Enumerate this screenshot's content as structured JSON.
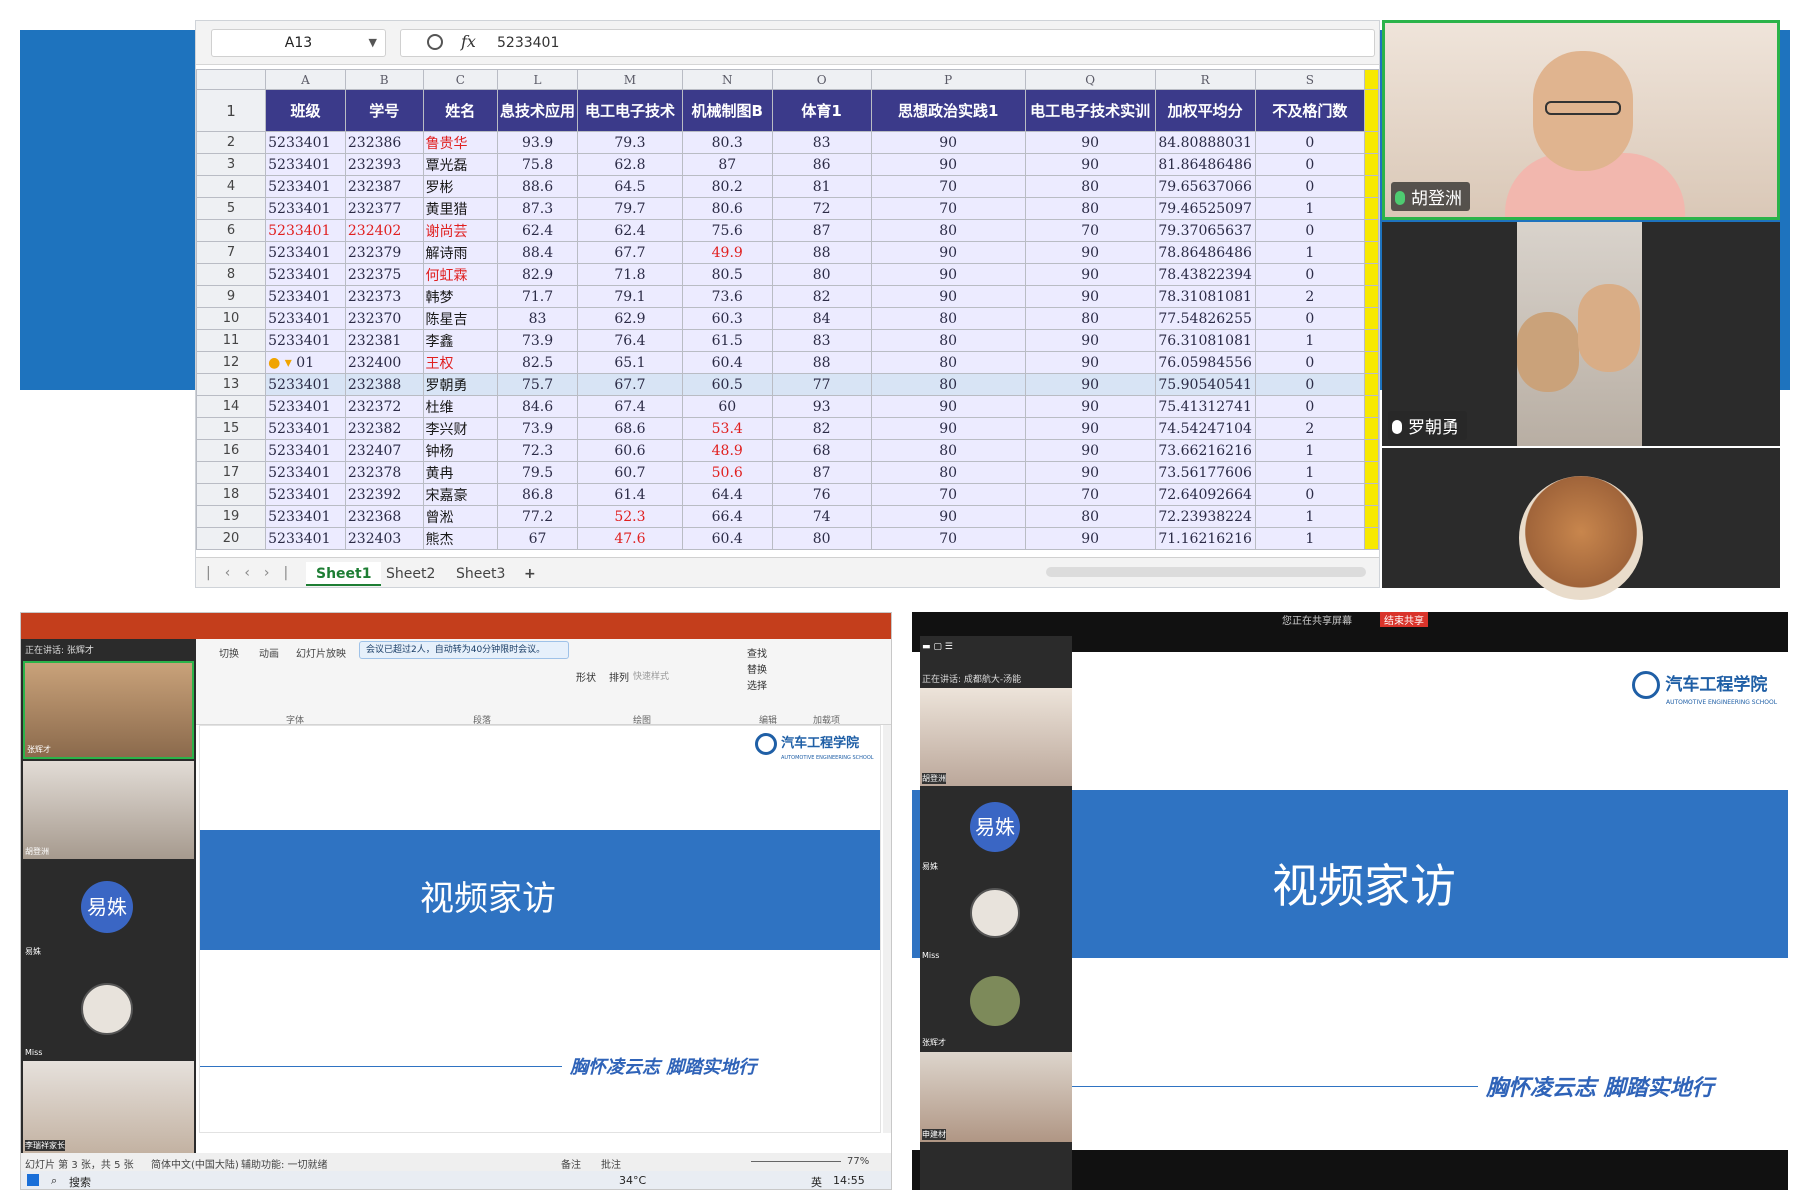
{
  "spreadsheet": {
    "cell_ref": "A13",
    "formula_value": "5233401",
    "column_letters": [
      "A",
      "B",
      "C",
      "L",
      "M",
      "N",
      "O",
      "P",
      "Q",
      "R",
      "S"
    ],
    "headers": [
      "班级",
      "学号",
      "姓名",
      "息技术应用",
      "电工电子技术",
      "机械制图B",
      "体育1",
      "思想政治实践1",
      "电工电子技术实训",
      "加权平均分",
      "不及格门数"
    ],
    "rows": [
      {
        "n": "2",
        "c": [
          "5233401",
          "232386",
          "鲁贵华",
          "93.9",
          "79.3",
          "80.3",
          "83",
          "90",
          "90",
          "84.80888031",
          "0"
        ]
      },
      {
        "n": "3",
        "c": [
          "5233401",
          "232393",
          "覃光磊",
          "75.8",
          "62.8",
          "87",
          "86",
          "90",
          "90",
          "81.86486486",
          "0"
        ]
      },
      {
        "n": "4",
        "c": [
          "5233401",
          "232387",
          "罗彬",
          "88.6",
          "64.5",
          "80.2",
          "81",
          "70",
          "80",
          "79.65637066",
          "0"
        ]
      },
      {
        "n": "5",
        "c": [
          "5233401",
          "232377",
          "黄里猎",
          "87.3",
          "79.7",
          "80.6",
          "72",
          "70",
          "80",
          "79.46525097",
          "1"
        ]
      },
      {
        "n": "6",
        "c": [
          "5233401",
          "232402",
          "谢尚芸",
          "62.4",
          "62.4",
          "75.6",
          "87",
          "80",
          "70",
          "79.37065637",
          "0"
        ]
      },
      {
        "n": "7",
        "c": [
          "5233401",
          "232379",
          "解诗雨",
          "88.4",
          "67.7",
          "49.9",
          "88",
          "90",
          "90",
          "78.86486486",
          "1"
        ]
      },
      {
        "n": "8",
        "c": [
          "5233401",
          "232375",
          "何虹霖",
          "82.9",
          "71.8",
          "80.5",
          "80",
          "90",
          "90",
          "78.43822394",
          "0"
        ]
      },
      {
        "n": "9",
        "c": [
          "5233401",
          "232373",
          "韩梦",
          "71.7",
          "79.1",
          "73.6",
          "82",
          "90",
          "90",
          "78.31081081",
          "2"
        ]
      },
      {
        "n": "10",
        "c": [
          "5233401",
          "232370",
          "陈星吉",
          "83",
          "62.9",
          "60.3",
          "84",
          "80",
          "80",
          "77.54826255",
          "0"
        ]
      },
      {
        "n": "11",
        "c": [
          "5233401",
          "232381",
          "李鑫",
          "73.9",
          "76.4",
          "61.5",
          "83",
          "80",
          "90",
          "76.31081081",
          "1"
        ]
      },
      {
        "n": "12",
        "c": [
          "01",
          "232400",
          "王权",
          "82.5",
          "65.1",
          "60.4",
          "88",
          "80",
          "90",
          "76.05984556",
          "0"
        ]
      },
      {
        "n": "13",
        "c": [
          "5233401",
          "232388",
          "罗朝勇",
          "75.7",
          "67.7",
          "60.5",
          "77",
          "80",
          "90",
          "75.90540541",
          "0"
        ]
      },
      {
        "n": "14",
        "c": [
          "5233401",
          "232372",
          "杜维",
          "84.6",
          "67.4",
          "60",
          "93",
          "90",
          "90",
          "75.41312741",
          "0"
        ]
      },
      {
        "n": "15",
        "c": [
          "5233401",
          "232382",
          "李兴财",
          "73.9",
          "68.6",
          "53.4",
          "82",
          "90",
          "90",
          "74.54247104",
          "2"
        ]
      },
      {
        "n": "16",
        "c": [
          "5233401",
          "232407",
          "钟杨",
          "72.3",
          "60.6",
          "48.9",
          "68",
          "80",
          "90",
          "73.66216216",
          "1"
        ]
      },
      {
        "n": "17",
        "c": [
          "5233401",
          "232378",
          "黄冉",
          "79.5",
          "60.7",
          "50.6",
          "87",
          "80",
          "90",
          "73.56177606",
          "1"
        ]
      },
      {
        "n": "18",
        "c": [
          "5233401",
          "232392",
          "宋嘉豪",
          "86.8",
          "61.4",
          "64.4",
          "76",
          "70",
          "70",
          "72.64092664",
          "0"
        ]
      },
      {
        "n": "19",
        "c": [
          "5233401",
          "232368",
          "曾淞",
          "77.2",
          "52.3",
          "66.4",
          "74",
          "90",
          "80",
          "72.23938224",
          "1"
        ]
      },
      {
        "n": "20",
        "c": [
          "5233401",
          "232403",
          "熊杰",
          "67",
          "47.6",
          "60.4",
          "80",
          "70",
          "90",
          "71.16216216",
          "1"
        ]
      }
    ],
    "sheets": [
      "Sheet1",
      "Sheet2",
      "Sheet3"
    ],
    "add_sheet": "+",
    "row_marks": {
      "warn_row": "12",
      "selected_row": "13"
    },
    "accent": "#3b3a8a",
    "red": "#e02020"
  },
  "top_participants": [
    {
      "name": "胡登洲",
      "mic_color": "#4ecb71"
    },
    {
      "name": "罗朝勇",
      "mic_color": "#ffffff"
    }
  ],
  "ppt": {
    "notice": "会议已超过2人，自动转为40分钟限时会议。",
    "speaking": "正在讲话: 张辉才",
    "ribbon_tabs": [
      "切换",
      "动画",
      "幻灯片放映"
    ],
    "ribbon_groups": [
      "字体",
      "段落",
      "绘图",
      "编辑",
      "加载项"
    ],
    "ribbon_buttons": [
      "形状",
      "排列",
      "快速样式",
      "查找",
      "替换",
      "选择"
    ],
    "participants": [
      "张辉才",
      "胡登洲",
      "易姝",
      "Miss",
      "李瑞祥家长"
    ],
    "avatar_text": "易姝",
    "slide_title": "视频家访",
    "logo_text": "汽车工程学院",
    "logo_sub": "AUTOMOTIVE ENGINEERING SCHOOL",
    "slogan": "胸怀凌云志 脚踏实地行",
    "status_left": "幻灯片 第 3 张，共 5 张",
    "status_lang": "简体中文(中国大陆)",
    "status_access": "辅助功能: 一切就绪",
    "status_notes": "备注",
    "status_comments": "批注",
    "zoom": "77%",
    "taskbar_search": "搜索",
    "weather": "34°C",
    "ime": "英",
    "time": "14:55"
  },
  "share": {
    "banner": "您正在共享屏幕",
    "stop": "结束共享",
    "speaking": "正在讲话: 成都航大-汤能",
    "participants": [
      "胡登洲",
      "易姝",
      "Miss",
      "张辉才",
      "申建材"
    ],
    "avatar_text": "易姝",
    "slide_title": "视频家访",
    "logo_text": "汽车工程学院",
    "logo_sub": "AUTOMOTIVE ENGINEERING SCHOOL",
    "slogan": "胸怀凌云志 脚踏实地行"
  }
}
